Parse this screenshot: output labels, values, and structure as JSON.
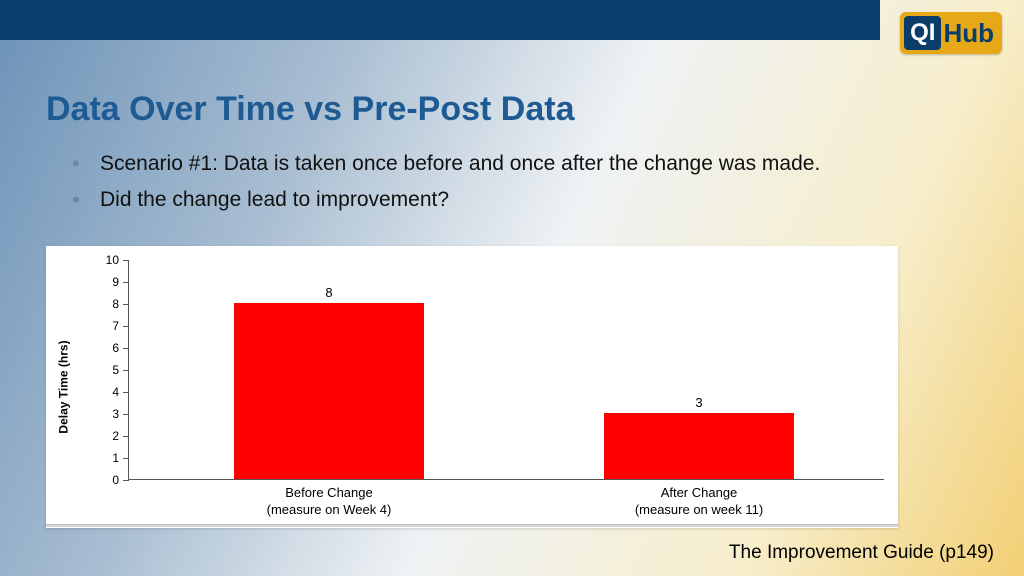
{
  "logo": {
    "qi": "QI",
    "hub": "Hub"
  },
  "title": "Data Over Time vs Pre-Post Data",
  "bullets": [
    "Scenario #1: Data is taken once before and once after the change was made.",
    "Did the change lead to improvement?"
  ],
  "footer": "The Improvement Guide (p149)",
  "chart_data": {
    "type": "bar",
    "categories": [
      "Before Change\n(measure on Week 4)",
      "After Change\n(measure on week 11)"
    ],
    "values": [
      8,
      3
    ],
    "title": "",
    "xlabel": "",
    "ylabel": "Delay Time (hrs)",
    "ylim": [
      0,
      10
    ],
    "yticks": [
      0,
      1,
      2,
      3,
      4,
      5,
      6,
      7,
      8,
      9,
      10
    ],
    "bar_color": "#ff0000"
  }
}
